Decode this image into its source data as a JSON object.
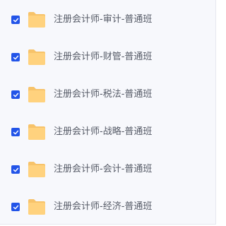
{
  "files": [
    {
      "label": "注册会计师-审计-普通班",
      "checked": true,
      "icon": "folder-icon"
    },
    {
      "label": "注册会计师-财管-普通班",
      "checked": true,
      "icon": "folder-icon"
    },
    {
      "label": "注册会计师-税法-普通班",
      "checked": true,
      "icon": "folder-icon"
    },
    {
      "label": "注册会计师-战略-普通班",
      "checked": true,
      "icon": "folder-icon"
    },
    {
      "label": "注册会计师-会计-普通班",
      "checked": true,
      "icon": "folder-icon"
    },
    {
      "label": "注册会计师-经济-普通班",
      "checked": true,
      "icon": "folder-icon"
    }
  ],
  "colors": {
    "checkbox": "#2254e8",
    "folder_back": "#f7c36a",
    "folder_front": "#ffd27e",
    "text": "#555a66",
    "panel_bg": "#f7f8fc"
  }
}
